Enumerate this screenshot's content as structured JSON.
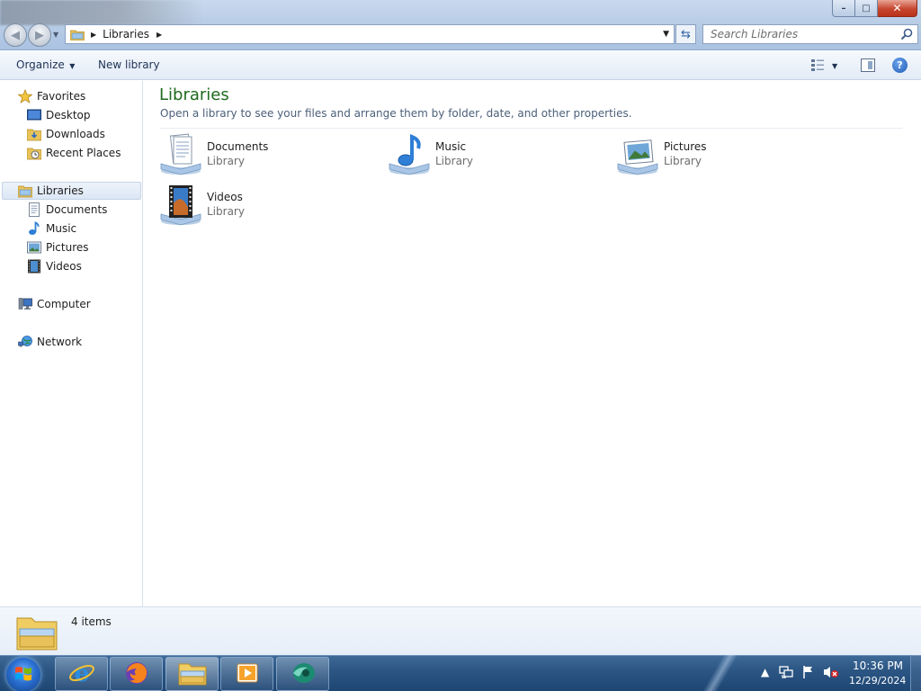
{
  "address_bar": {
    "crumbs": [
      "Libraries"
    ],
    "search_placeholder": "Search Libraries"
  },
  "window_controls": {
    "minimize": "–",
    "maximize": "□",
    "close": "✕"
  },
  "toolbar": {
    "organize_label": "Organize",
    "new_library_label": "New library"
  },
  "nav": {
    "favorites": {
      "label": "Favorites",
      "items": [
        "Desktop",
        "Downloads",
        "Recent Places"
      ]
    },
    "libraries": {
      "label": "Libraries",
      "items": [
        "Documents",
        "Music",
        "Pictures",
        "Videos"
      ]
    },
    "computer": "Computer",
    "network": "Network"
  },
  "content": {
    "title": "Libraries",
    "subtitle": "Open a library to see your files and arrange them by folder, date, and other properties.",
    "libraries": [
      {
        "name": "Documents",
        "type": "Library",
        "icon": "documents-library-icon"
      },
      {
        "name": "Music",
        "type": "Library",
        "icon": "music-library-icon"
      },
      {
        "name": "Pictures",
        "type": "Library",
        "icon": "pictures-library-icon"
      },
      {
        "name": "Videos",
        "type": "Library",
        "icon": "videos-library-icon"
      }
    ]
  },
  "details": {
    "item_count": "4 items"
  },
  "taskbar": {
    "pinned": [
      "internet-explorer-icon",
      "firefox-icon",
      "windows-explorer-icon",
      "media-player-icon",
      "app-icon"
    ],
    "clock_time": "10:36 PM",
    "clock_date": "12/29/2024"
  },
  "colors": {
    "title_green": "#1e6a1e",
    "selection": "#dce7f5",
    "taskbar": "#2c5684"
  }
}
